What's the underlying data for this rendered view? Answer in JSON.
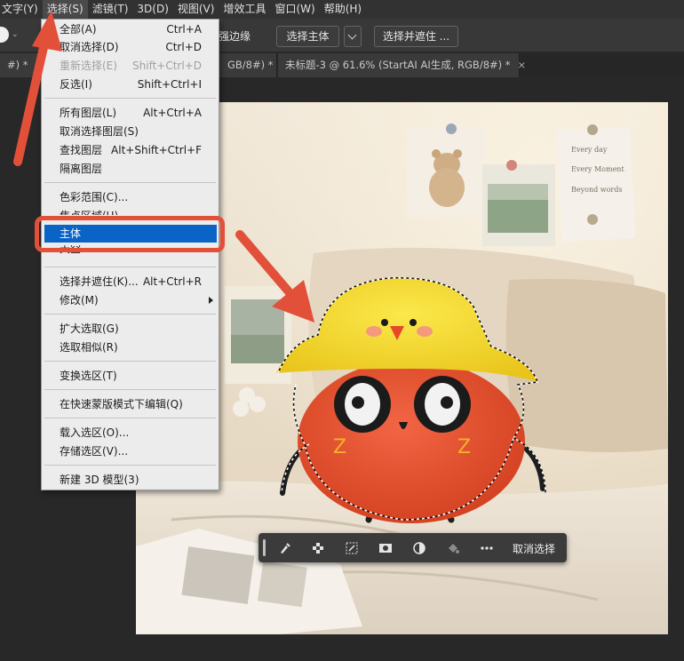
{
  "menubar": {
    "items": [
      {
        "label": "文字(Y)"
      },
      {
        "label": "选择(S)"
      },
      {
        "label": "滤镜(T)"
      },
      {
        "label": "3D(D)"
      },
      {
        "label": "视图(V)"
      },
      {
        "label": "增效工具"
      },
      {
        "label": "窗口(W)"
      },
      {
        "label": "帮助(H)"
      }
    ]
  },
  "options": {
    "enhance_edge": "强边缘",
    "select_subject": "选择主体",
    "select_and_mask": "选择并遮住 ..."
  },
  "tabs": [
    {
      "label": "#) *"
    },
    {
      "label": "GB/8#) *"
    },
    {
      "label": "未标题-3 @ 61.6% (StartAI AI生成, RGB/8#) *"
    }
  ],
  "select_menu": {
    "items": [
      {
        "label": "全部(A)",
        "shortcut": "Ctrl+A"
      },
      {
        "label": "取消选择(D)",
        "shortcut": "Ctrl+D"
      },
      {
        "label": "重新选择(E)",
        "shortcut": "Shift+Ctrl+D"
      },
      {
        "label": "反选(I)",
        "shortcut": "Shift+Ctrl+I"
      },
      {
        "label": "所有图层(L)",
        "shortcut": "Alt+Ctrl+A"
      },
      {
        "label": "取消选择图层(S)",
        "shortcut": ""
      },
      {
        "label": "查找图层",
        "shortcut": "Alt+Shift+Ctrl+F"
      },
      {
        "label": "隔离图层",
        "shortcut": ""
      },
      {
        "label": "色彩范围(C)...",
        "shortcut": ""
      },
      {
        "label": "焦点区域(U)...",
        "shortcut": ""
      },
      {
        "label": "主体",
        "shortcut": ""
      },
      {
        "label": "天空",
        "shortcut": ""
      },
      {
        "label": "选择并遮住(K)...",
        "shortcut": "Alt+Ctrl+R"
      },
      {
        "label": "修改(M)",
        "shortcut": ""
      },
      {
        "label": "扩大选取(G)",
        "shortcut": ""
      },
      {
        "label": "选取相似(R)",
        "shortcut": ""
      },
      {
        "label": "变换选区(T)",
        "shortcut": ""
      },
      {
        "label": "在快速蒙版模式下编辑(Q)",
        "shortcut": ""
      },
      {
        "label": "载入选区(O)...",
        "shortcut": ""
      },
      {
        "label": "存储选区(V)...",
        "shortcut": ""
      },
      {
        "label": "新建 3D 模型(3)",
        "shortcut": ""
      }
    ]
  },
  "selection_bar": {
    "cancel_label": "取消选择"
  },
  "canvas": {
    "note_lines": [
      "Every day",
      "Every Moment",
      "Beyond words"
    ]
  },
  "colors": {
    "highlight": "#0a64c8",
    "annotation": "#e3503a"
  }
}
